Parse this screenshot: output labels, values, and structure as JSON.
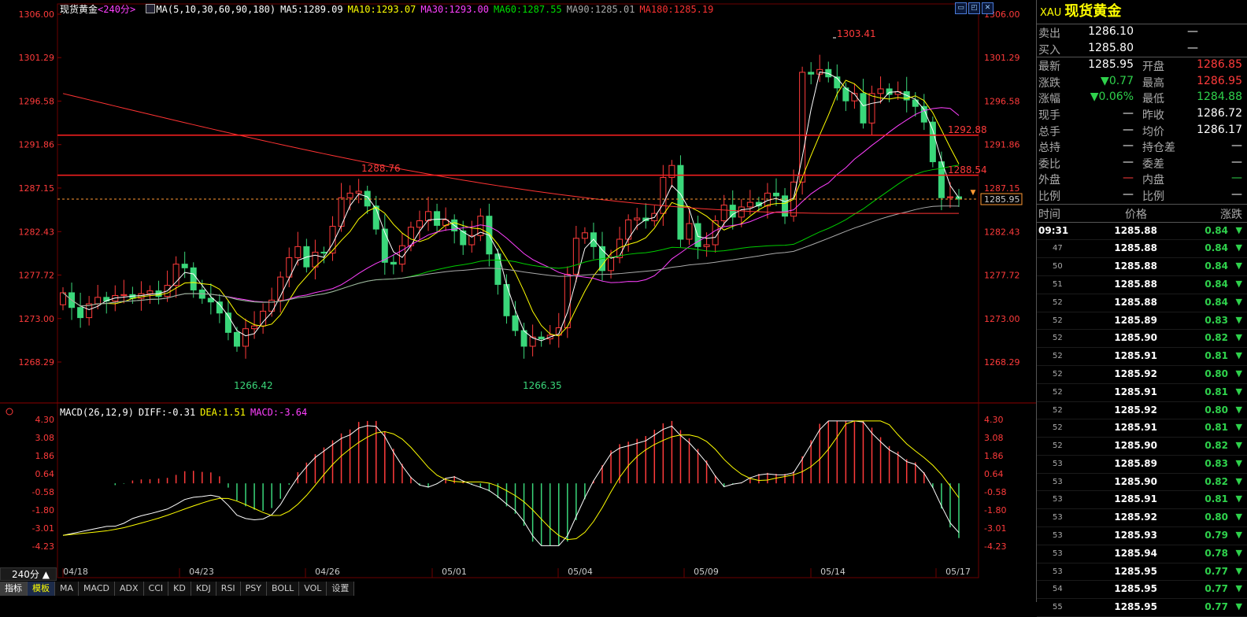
{
  "chart": {
    "instrument": "现货黄金",
    "period": "240分",
    "ma_legend": {
      "label": "MA(5,10,30,60,90,180)",
      "ma5": "MA5:1289.09",
      "ma10": "MA10:1293.07",
      "ma30": "MA30:1293.00",
      "ma60": "MA60:1287.55",
      "ma90": "MA90:1285.01",
      "ma180": "MA180:1285.19"
    },
    "y_ticks": [
      "1306.00",
      "1301.29",
      "1296.58",
      "1291.86",
      "1287.15",
      "1282.43",
      "1277.72",
      "1273.00",
      "1268.29"
    ],
    "price_tag": "1285.95",
    "annotations": {
      "high": "1303.41",
      "low1": "1266.42",
      "low2": "1266.35",
      "mark1": "1288.76",
      "line1": "1292.88",
      "line2": "1288.54"
    },
    "x_labels": [
      "04/18",
      "04/23",
      "04/26",
      "05/01",
      "05/04",
      "05/09",
      "05/14",
      "05/17"
    ],
    "macd_legend": {
      "label": "MACD(26,12,9)",
      "diff": "DIFF:-0.31",
      "dea": "DEA:1.51",
      "macd": "MACD:-3.64"
    },
    "macd_ticks": [
      "4.30",
      "3.08",
      "1.86",
      "0.64",
      "-0.58",
      "-1.80",
      "-3.01",
      "-4.23"
    ],
    "colors": {
      "up": "#ff3b3b",
      "down": "#3ad77a",
      "ma5": "#ffffff",
      "ma10": "#ffff00",
      "ma30": "#ff40ff",
      "ma60": "#00cc00",
      "ma90": "#aaaaaa",
      "ma180": "#ff3333"
    }
  },
  "window_buttons": [
    "restore-icon",
    "maximize-icon",
    "close-icon"
  ],
  "bottom": {
    "period_button": "240分 ▲",
    "tabs": [
      "指标",
      "模板",
      "MA",
      "MACD",
      "ADX",
      "CCI",
      "KD",
      "KDJ",
      "RSI",
      "PSY",
      "BOLL",
      "VOL",
      "设置"
    ]
  },
  "panel": {
    "code": "XAU",
    "name": "现货黄金",
    "sell_label": "卖出",
    "sell": "1286.10",
    "sell_qty": "—",
    "buy_label": "买入",
    "buy": "1285.80",
    "buy_qty": "—",
    "quote": [
      {
        "l1": "最新",
        "v1": "1285.95",
        "l2": "开盘",
        "v2": "1286.85"
      },
      {
        "l1": "涨跌",
        "v1": "▼0.77",
        "l2": "最高",
        "v2": "1286.95"
      },
      {
        "l1": "涨幅",
        "v1": "▼0.06%",
        "l2": "最低",
        "v2": "1284.88"
      },
      {
        "l1": "现手",
        "v1": "—",
        "l2": "昨收",
        "v2": "1286.72"
      },
      {
        "l1": "总手",
        "v1": "—",
        "l2": "均价",
        "v2": "1286.17"
      },
      {
        "l1": "总持",
        "v1": "—",
        "l2": "持仓差",
        "v2": "—"
      },
      {
        "l1": "委比",
        "v1": "—",
        "l2": "委差",
        "v2": "—"
      },
      {
        "l1": "外盘",
        "v1": "—",
        "l2": "内盘",
        "v2": "—"
      },
      {
        "l1": "比例",
        "v1": "—",
        "l2": "比例",
        "v2": "—"
      }
    ],
    "ticks_header": {
      "time": "时间",
      "price": "价格",
      "change": "涨跌"
    },
    "ticks": [
      {
        "t": "09:31",
        "p": "1285.88",
        "c": "0.84"
      },
      {
        "t": "47",
        "p": "1285.88",
        "c": "0.84"
      },
      {
        "t": "50",
        "p": "1285.88",
        "c": "0.84"
      },
      {
        "t": "51",
        "p": "1285.88",
        "c": "0.84"
      },
      {
        "t": "52",
        "p": "1285.88",
        "c": "0.84"
      },
      {
        "t": "52",
        "p": "1285.89",
        "c": "0.83"
      },
      {
        "t": "52",
        "p": "1285.90",
        "c": "0.82"
      },
      {
        "t": "52",
        "p": "1285.91",
        "c": "0.81"
      },
      {
        "t": "52",
        "p": "1285.92",
        "c": "0.80"
      },
      {
        "t": "52",
        "p": "1285.91",
        "c": "0.81"
      },
      {
        "t": "52",
        "p": "1285.92",
        "c": "0.80"
      },
      {
        "t": "52",
        "p": "1285.91",
        "c": "0.81"
      },
      {
        "t": "52",
        "p": "1285.90",
        "c": "0.82"
      },
      {
        "t": "53",
        "p": "1285.89",
        "c": "0.83"
      },
      {
        "t": "53",
        "p": "1285.90",
        "c": "0.82"
      },
      {
        "t": "53",
        "p": "1285.91",
        "c": "0.81"
      },
      {
        "t": "53",
        "p": "1285.92",
        "c": "0.80"
      },
      {
        "t": "53",
        "p": "1285.93",
        "c": "0.79"
      },
      {
        "t": "53",
        "p": "1285.94",
        "c": "0.78"
      },
      {
        "t": "53",
        "p": "1285.95",
        "c": "0.77"
      },
      {
        "t": "54",
        "p": "1285.95",
        "c": "0.77"
      },
      {
        "t": "55",
        "p": "1285.95",
        "c": "0.77"
      }
    ]
  }
}
